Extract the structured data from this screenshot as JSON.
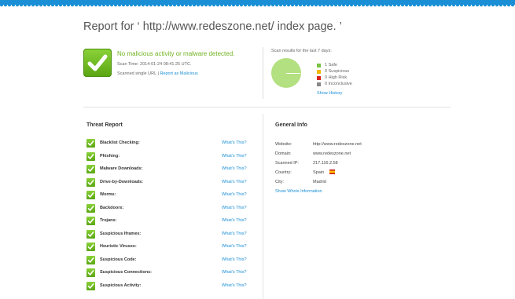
{
  "title": "Report for ‘ http://www.redeszone.net/ index page. ’",
  "summary": {
    "verdict": "No malicious activity or malware detected.",
    "scan_time": "Scan Time: 2014-01-24 08:41:25 UTC.",
    "scanned_note": "Scanned single URL |",
    "report_link": "Report as Malicious"
  },
  "results": {
    "heading": "Scan results for the last 7 days:",
    "legend": [
      {
        "label": "1 Safe",
        "color": "#7ac142"
      },
      {
        "label": "0 Suspicious",
        "color": "#f5b800"
      },
      {
        "label": "0 High Risk",
        "color": "#d9231d"
      },
      {
        "label": "0 Inconclusive",
        "color": "#888888"
      }
    ],
    "pie_color": "#b3e080",
    "show_history": "Show History"
  },
  "threat_report": {
    "title": "Threat Report",
    "link_label": "What's This?",
    "rows": [
      "Blacklist Checking:",
      "Phishing:",
      "Malware Downloads:",
      "Drive-by-Downloads:",
      "Worms:",
      "Backdoors:",
      "Trojans:",
      "Suspicious Iframes:",
      "Heuristic Viruses:",
      "Suspicious Code:",
      "Suspicious Connections:",
      "Suspicious Activity:"
    ]
  },
  "general_info": {
    "title": "General Info",
    "rows": [
      {
        "label": "Website:",
        "value": "http://www.redeszone.net"
      },
      {
        "label": "Domain:",
        "value": "www.redeszone.net"
      },
      {
        "label": "Scanned IP:",
        "value": "217.116.2.58"
      },
      {
        "label": "Country:",
        "value": "Spain"
      },
      {
        "label": "City:",
        "value": "Madrid"
      }
    ],
    "whois_link": "Show Whois Information"
  },
  "colors": {
    "accent": "#1a8fd6",
    "safe_green": "#72b323"
  }
}
